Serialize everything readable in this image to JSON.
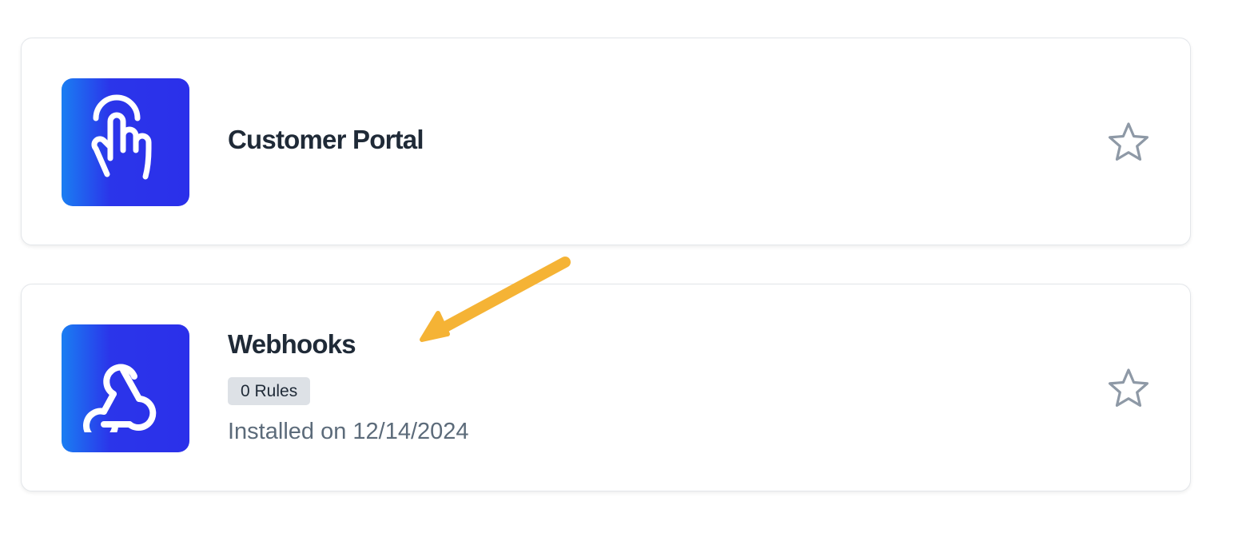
{
  "apps": [
    {
      "name": "Customer Portal",
      "icon": "touch-hand-icon"
    },
    {
      "name": "Webhooks",
      "icon": "webhook-icon",
      "rules_badge": "0 Rules",
      "installed": "Installed on 12/14/2024"
    }
  ],
  "favorite_icon": "star-outline-icon",
  "colors": {
    "icon_gradient_start": "#1a7ef2",
    "icon_gradient_end": "#2b30ea",
    "title": "#1f2a37",
    "muted": "#5c6b7a",
    "badge_bg": "#dde1e6",
    "star": "#8e99a6",
    "annotation_arrow": "#f5b335"
  }
}
